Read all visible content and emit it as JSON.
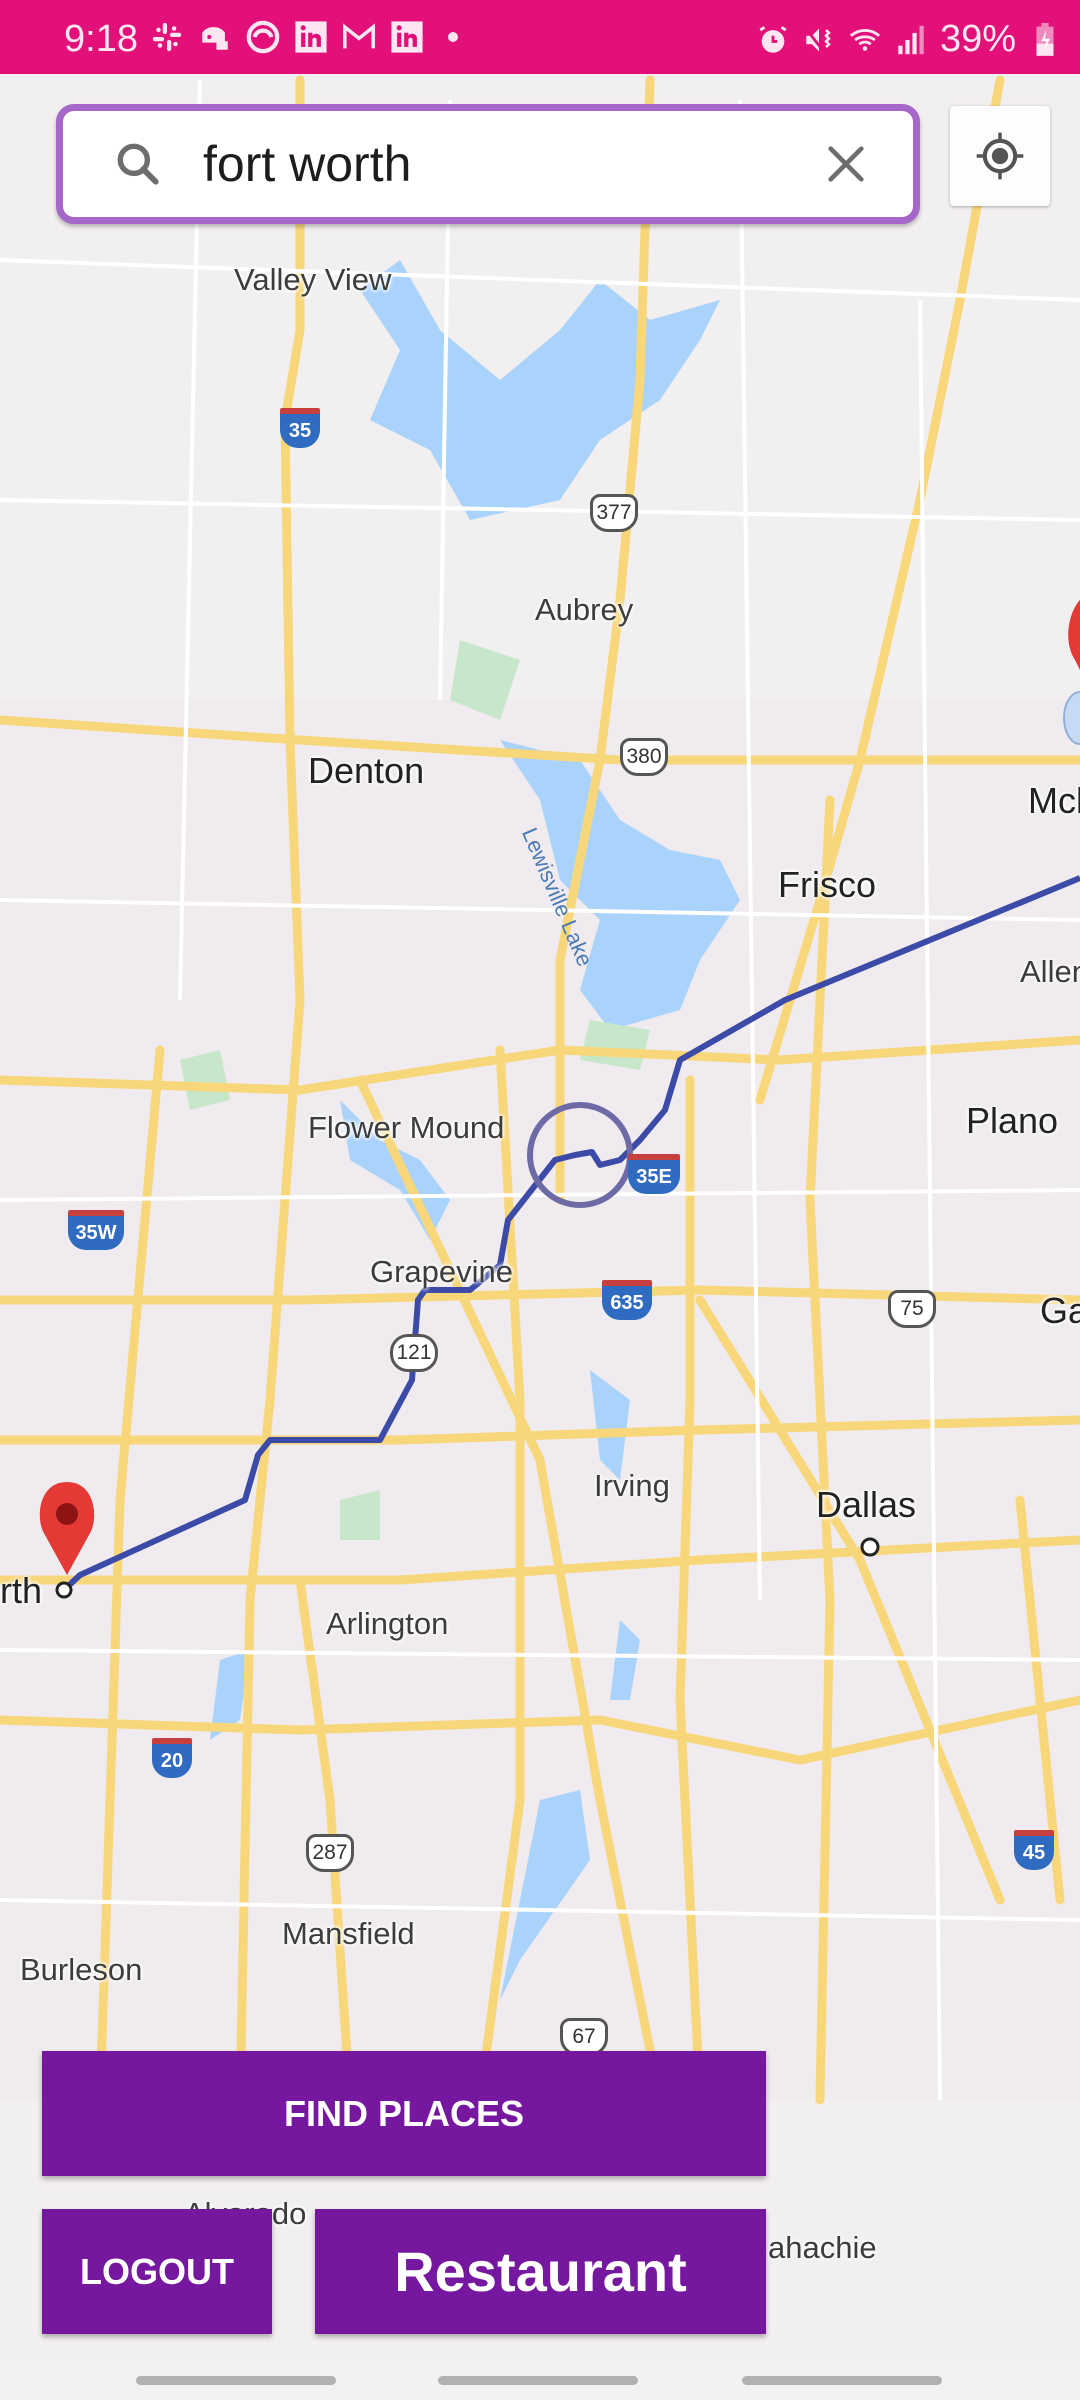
{
  "status_bar": {
    "time": "9:18",
    "notification_icons": [
      "slack-icon",
      "discord-icon",
      "swirl-app-icon",
      "linkedin-icon",
      "gmail-icon",
      "linkedin-icon"
    ],
    "system_icons": [
      "alarm-icon",
      "vibrate-mute-icon",
      "wifi-icon",
      "signal-icon"
    ],
    "battery_percent": "39%",
    "colors": {
      "background": "#e3107a",
      "foreground": "#fbe6f1"
    }
  },
  "search": {
    "value": "fort worth",
    "placeholder": "",
    "border_color": "#a667c9"
  },
  "map": {
    "city_labels": [
      "Valley View",
      "Aubrey",
      "Denton",
      "Frisco",
      "McKinney",
      "Allen",
      "Flower Mound",
      "Plano",
      "Grapevine",
      "Garland",
      "Irving",
      "Dallas",
      "Fort Worth",
      "Arlington",
      "Mansfield",
      "Burleson",
      "Alvarado",
      "Waxahachie"
    ],
    "visible_labels": {
      "valley_view": "Valley View",
      "aubrey": "Aubrey",
      "denton": "Denton",
      "frisco": "Frisco",
      "mckinney": "Mck",
      "allen": "Allen",
      "flower_mound": "Flower Mound",
      "plano": "Plano",
      "grapevine": "Grapevine",
      "garland": "Ga",
      "irving": "Irving",
      "dallas": "Dallas",
      "fort_worth": "rth",
      "arlington": "Arlington",
      "mansfield": "Mansfield",
      "burleson": "Burleson",
      "alvarado": "Alvarado",
      "waxahachie": "ahachie",
      "lake": "Lewisville Lake"
    },
    "shields": {
      "i35": "35",
      "us377": "377",
      "us380": "380",
      "i35e": "35E",
      "i35w": "35W",
      "i635": "635",
      "us75": "75",
      "sh121": "121",
      "i20": "20",
      "us287": "287",
      "i45": "45",
      "us67": "67"
    },
    "route_color": "#3d4ba8",
    "marker_color": "#e53935"
  },
  "buttons": {
    "find_places": "FIND PLACES",
    "logout": "LOGOUT",
    "restaurant": "Restaurant",
    "color": "#7617a0"
  }
}
